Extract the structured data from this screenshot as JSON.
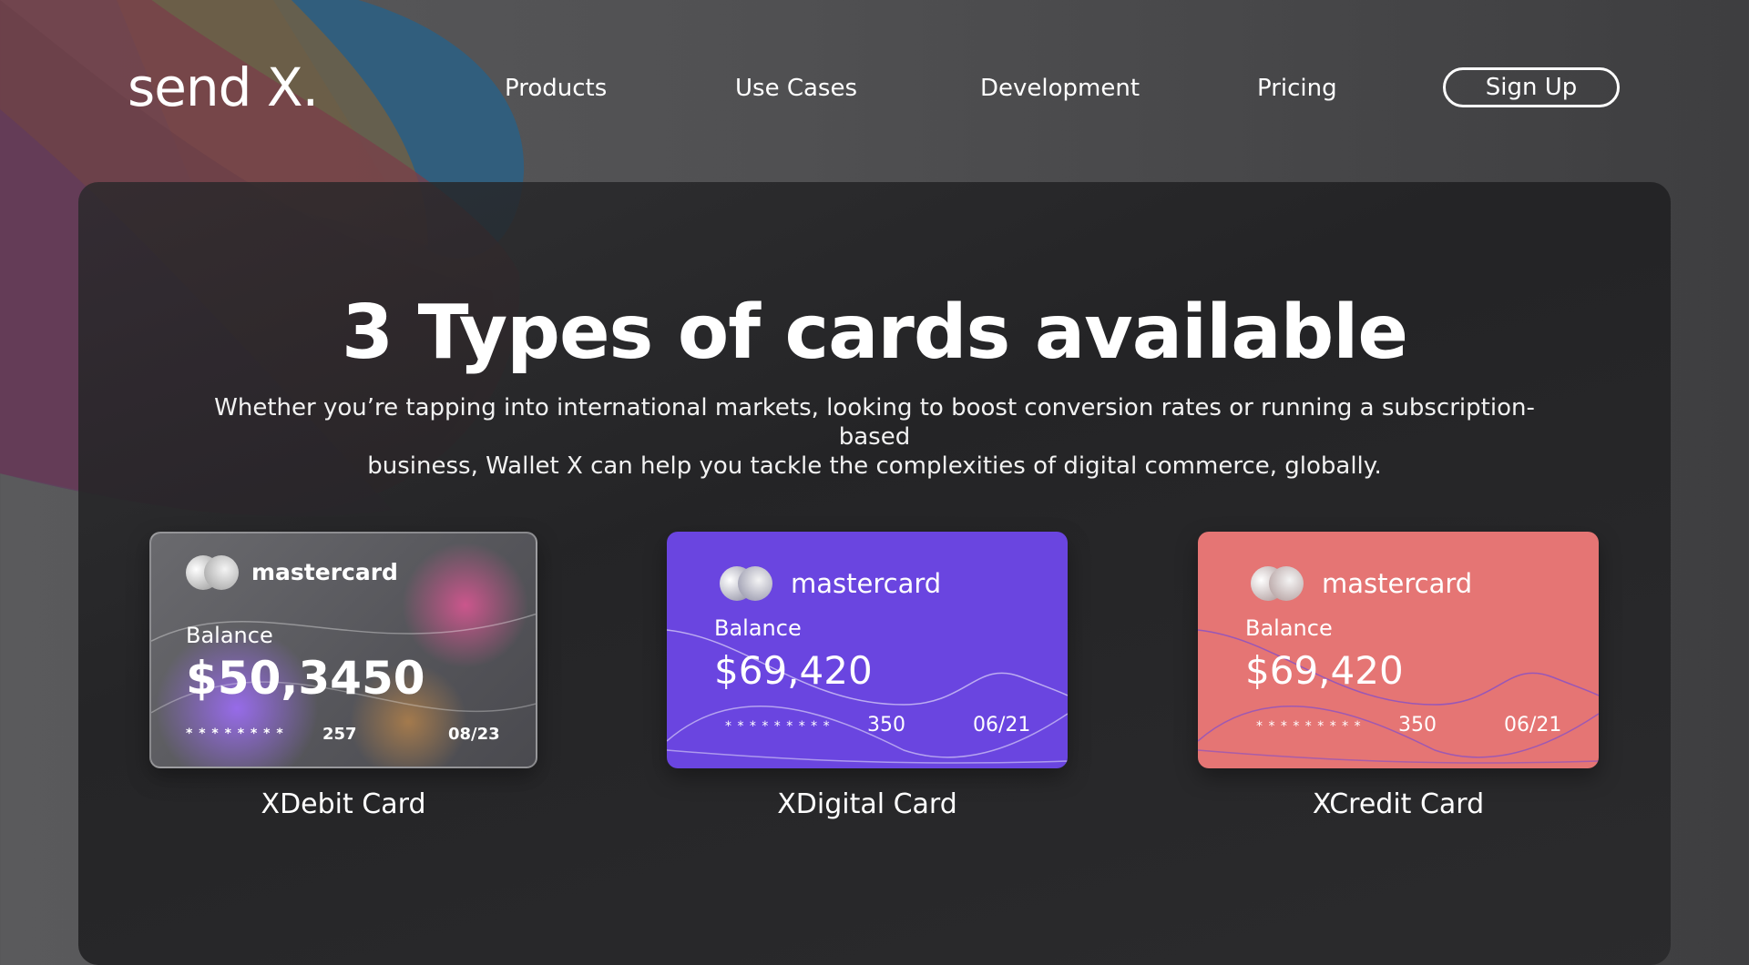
{
  "brand": {
    "logo": "send X."
  },
  "nav": {
    "items": [
      {
        "label": "Products"
      },
      {
        "label": "Use Cases"
      },
      {
        "label": "Development"
      },
      {
        "label": "Pricing"
      }
    ],
    "signup_label": "Sign Up"
  },
  "hero": {
    "title": "3 Types of cards available",
    "subtitle_line1": "Whether you’re tapping into international markets, looking to boost conversion rates or running a subscription-based",
    "subtitle_line2": "business, Wallet X can help you tackle the complexities of digital commerce, globally."
  },
  "cards": [
    {
      "name": "XDebit Card",
      "network": "mastercard",
      "balance_label": "Balance",
      "balance": "$50,3450",
      "masked_number": "* * * * * * * *",
      "cvv": "257",
      "expiry": "08/23",
      "color": "#5e5e62"
    },
    {
      "name": "XDigital Card",
      "network": "mastercard",
      "balance_label": "Balance",
      "balance": "$69,420",
      "masked_number": "* * * * * * * * *",
      "cvv": "350",
      "expiry": "06/21",
      "color": "#6a45e0"
    },
    {
      "name": "XCredit Card",
      "network": "mastercard",
      "balance_label": "Balance",
      "balance": "$69,420",
      "masked_number": "* * * * * * * * *",
      "cvv": "350",
      "expiry": "06/21",
      "color": "#e57574"
    }
  ]
}
